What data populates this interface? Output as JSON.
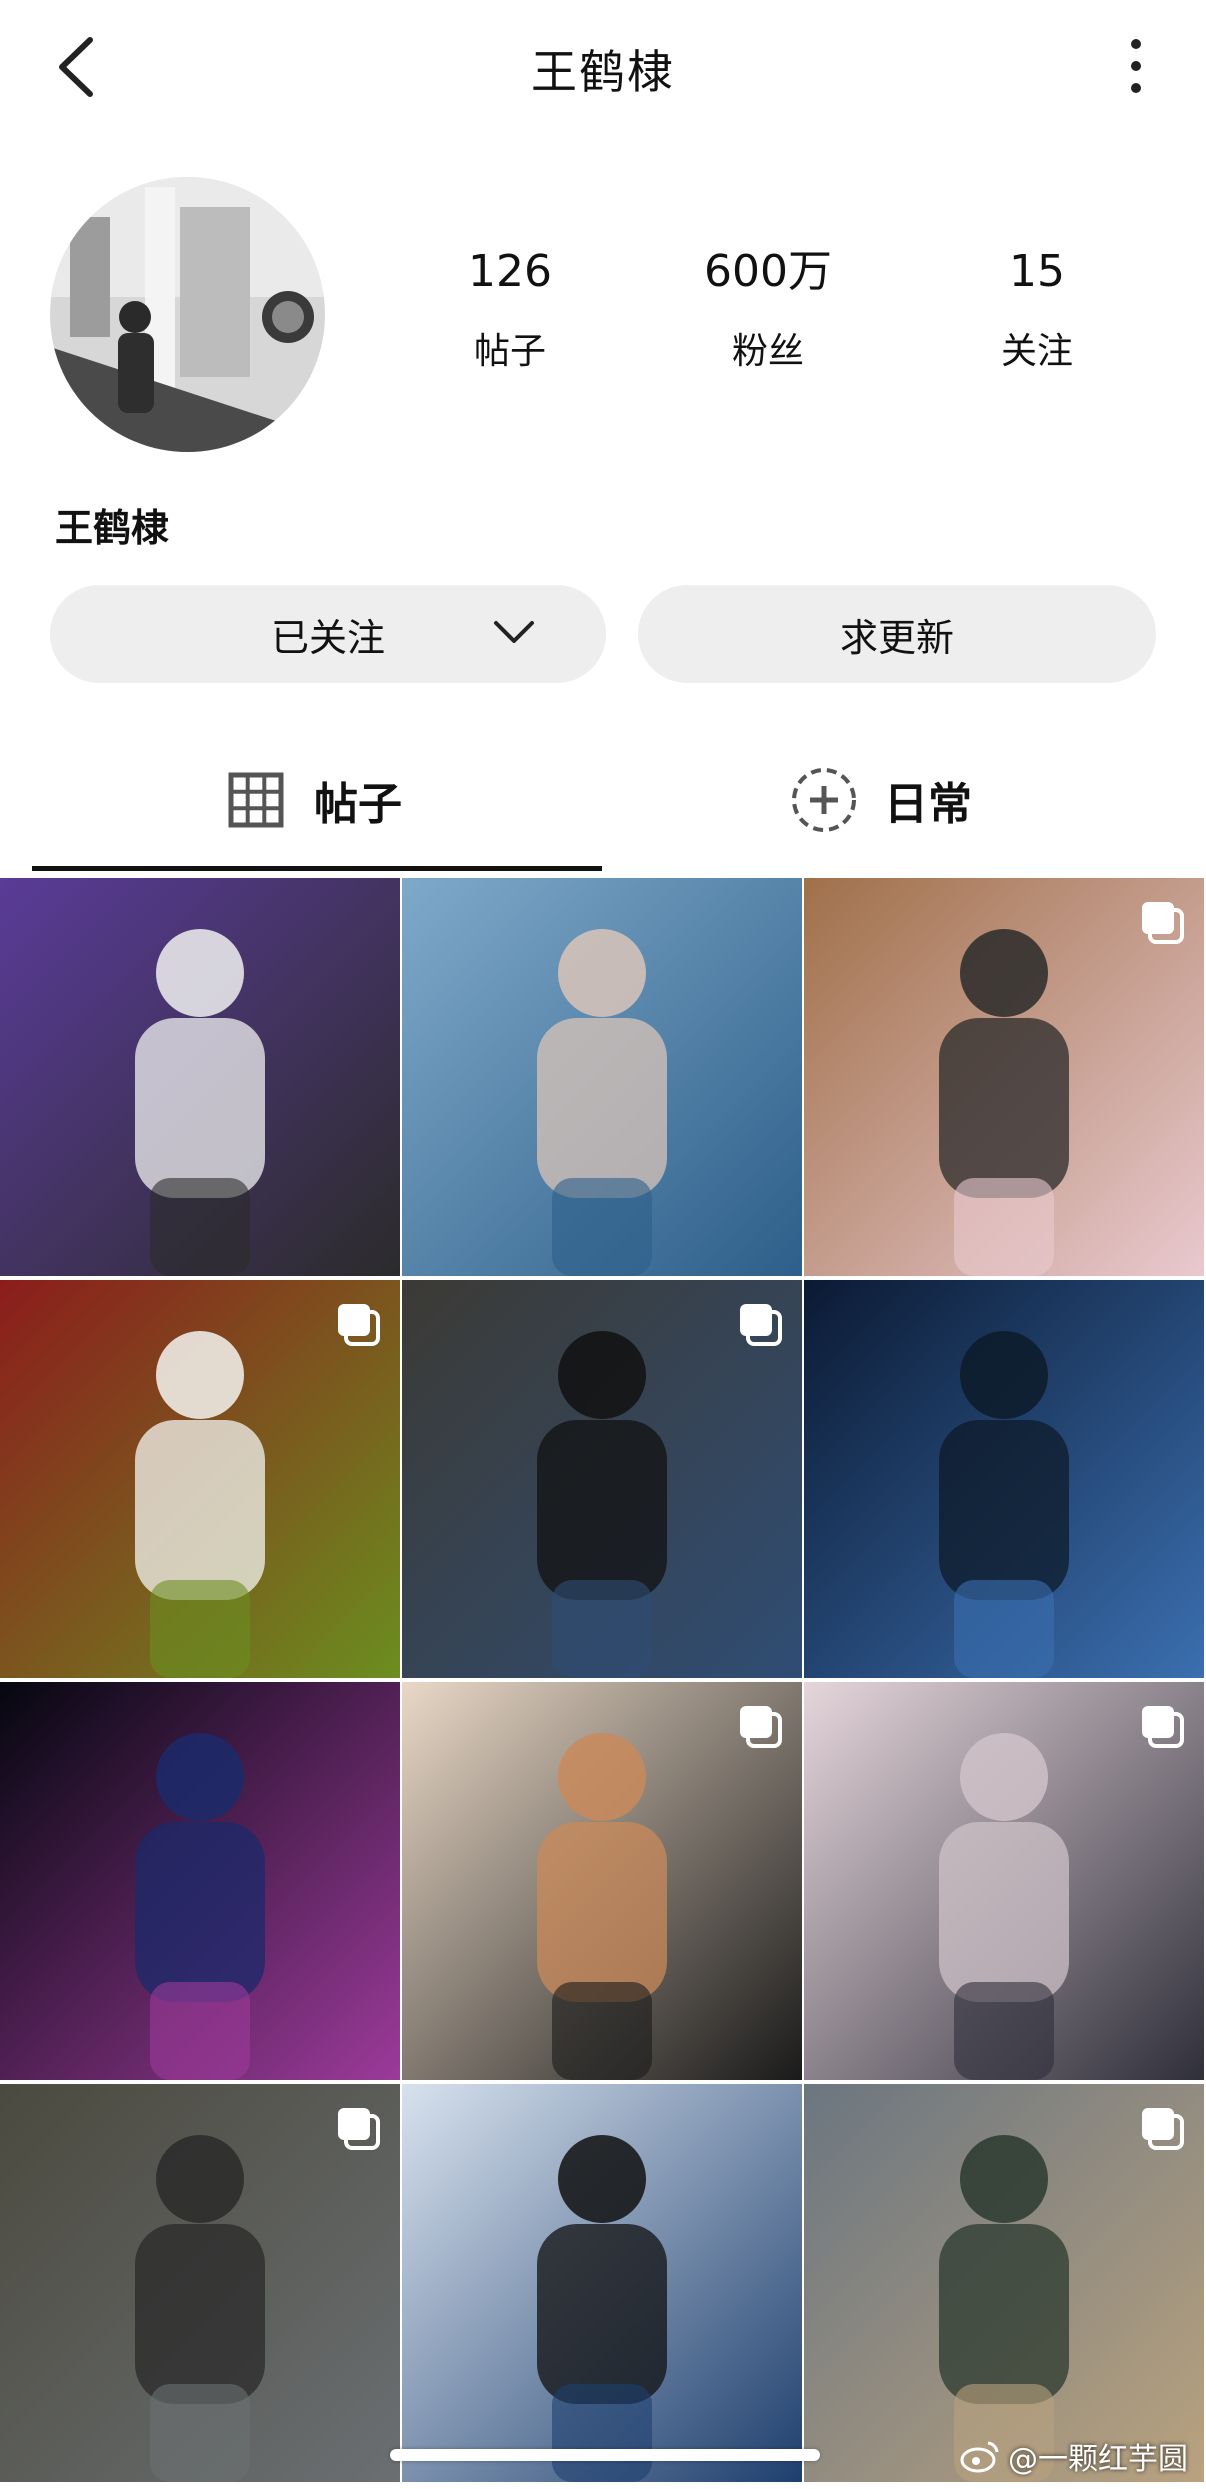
{
  "header": {
    "title": "王鹤棣"
  },
  "profile": {
    "name": "王鹤棣",
    "stats": [
      {
        "value": "126",
        "label": "帖子"
      },
      {
        "value": "600万",
        "label": "粉丝"
      },
      {
        "value": "15",
        "label": "关注"
      }
    ]
  },
  "actions": {
    "follow_label": "已关注",
    "update_label": "求更新"
  },
  "tabs": [
    {
      "label": "帖子",
      "icon": "grid-icon",
      "active": true
    },
    {
      "label": "日常",
      "icon": "add-circle-icon",
      "active": false
    }
  ],
  "posts": [
    {
      "multi": false,
      "colors": [
        "#5a3b98",
        "#2b2b2b",
        "#f0f0f0"
      ]
    },
    {
      "multi": false,
      "colors": [
        "#7fa9c9",
        "#2d5f8a",
        "#d9c4b8"
      ]
    },
    {
      "multi": true,
      "colors": [
        "#a0704a",
        "#e9c9cf",
        "#2a2a2a"
      ]
    },
    {
      "multi": true,
      "colors": [
        "#8c1c1c",
        "#6b8e1f",
        "#f4f4f0"
      ]
    },
    {
      "multi": true,
      "colors": [
        "#3c3a35",
        "#2f4d74",
        "#111111"
      ]
    },
    {
      "multi": false,
      "colors": [
        "#0b1a33",
        "#3b6fb0",
        "#0d1b2a"
      ]
    },
    {
      "multi": false,
      "colors": [
        "#05070f",
        "#9c3a9a",
        "#1b2a6b"
      ]
    },
    {
      "multi": true,
      "colors": [
        "#e9d8c6",
        "#1a1a1a",
        "#c98a5a"
      ]
    },
    {
      "multi": true,
      "colors": [
        "#e6d6dc",
        "#2f2f3a",
        "#cfc2c8"
      ]
    },
    {
      "multi": true,
      "colors": [
        "#4b4a3f",
        "#6b6f72",
        "#2a2a2a"
      ]
    },
    {
      "multi": false,
      "colors": [
        "#d8e2ee",
        "#1e3f6e",
        "#111111"
      ]
    },
    {
      "multi": true,
      "colors": [
        "#6b7680",
        "#b9a27f",
        "#2b3a2f"
      ]
    }
  ],
  "watermark": {
    "text": "@一颗红芋圆"
  }
}
